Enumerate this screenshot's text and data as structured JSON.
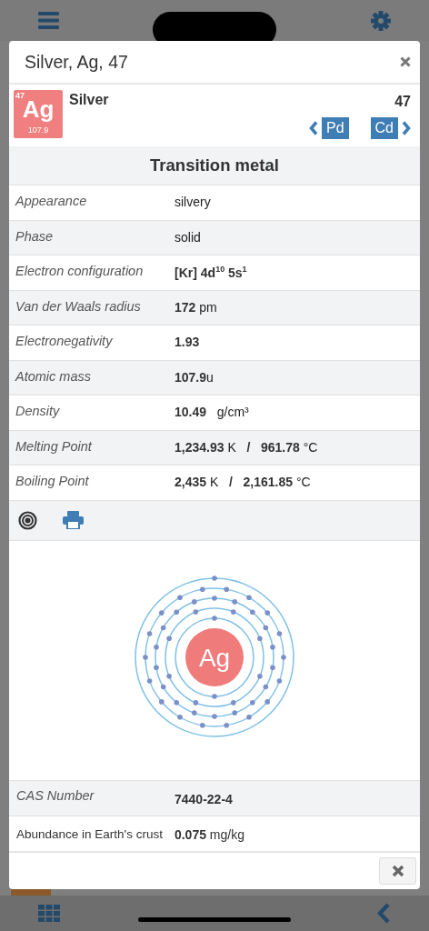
{
  "modal": {
    "title": "Silver, Ag, 47",
    "element": {
      "tile_number": "47",
      "tile_symbol": "Ag",
      "tile_mass": "107.9",
      "name": "Silver",
      "number": "47",
      "previous": "Pd",
      "next": "Cd"
    },
    "category": "Transition metal",
    "properties": [
      {
        "label": "Appearance",
        "value": "silvery"
      },
      {
        "label": "Phase",
        "value": "solid"
      },
      {
        "label": "Electron configuration",
        "value": "**[Kr] 4d**$^{10}$ **5s**$^{1}$"
      },
      {
        "label": "Van der Waals radius",
        "value": "**172** pm"
      },
      {
        "label": "Electronegativity",
        "value": "**1.93**"
      },
      {
        "label": "Atomic mass",
        "value": "**107.9**u"
      },
      {
        "label": "Density",
        "value": "**10.49**   g/cm³"
      },
      {
        "label": "Melting Point",
        "value": "**1,234.93** K   **/**   **961.78** °C"
      },
      {
        "label": "Boiling Point",
        "value": "**2,435** K   **/**   **2,161.85** °C"
      }
    ],
    "diagram": {
      "symbol": "Ag"
    },
    "extra": [
      {
        "kind": "italic",
        "label": "CAS Number",
        "value": "**7440-22-4**"
      },
      {
        "kind": "plain",
        "label": "Abundance in Earth's crust",
        "value": "**0.075** mg/kg"
      }
    ]
  }
}
